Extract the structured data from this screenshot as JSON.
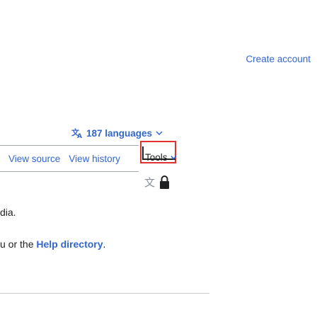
{
  "header": {
    "create_account": "Create account"
  },
  "language": {
    "label": "187 languages"
  },
  "tabs": {
    "view_source": "View source",
    "view_history": "View history",
    "tools": "Tools"
  },
  "content": {
    "fragment": "dia.",
    "help_prefix": "u or the ",
    "help_link": "Help directory",
    "help_suffix": "."
  }
}
